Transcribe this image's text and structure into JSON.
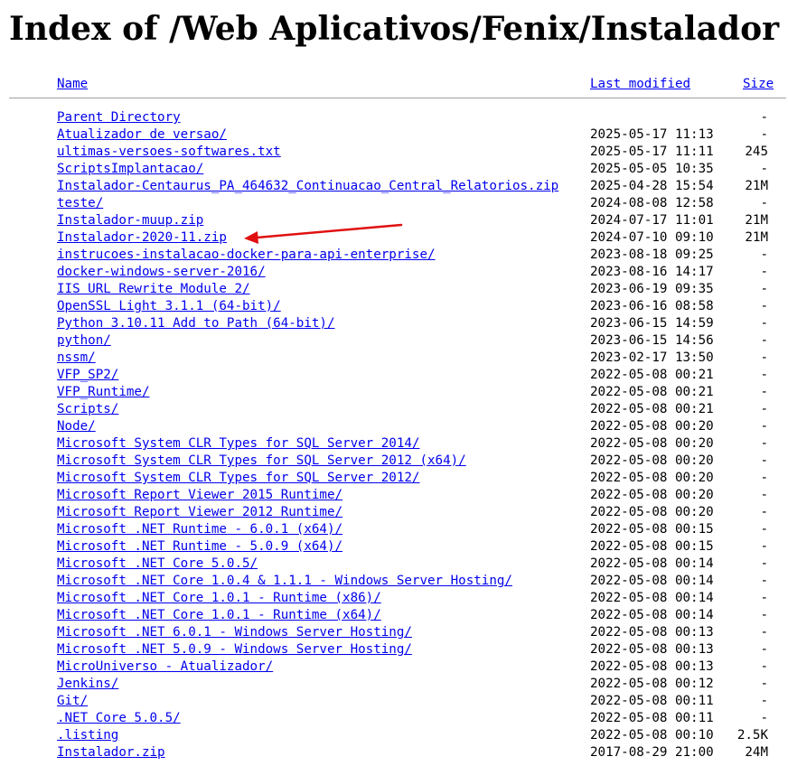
{
  "page": {
    "title": "Index of /Web Aplicativos/Fenix/Instalador"
  },
  "columns": {
    "name": "Name",
    "last_modified": "Last modified",
    "size": "Size"
  },
  "colors": {
    "link": "#0000ee",
    "arrow": "#e01010"
  },
  "annotation": {
    "icon": "red-arrow-icon",
    "points_to_row": 7
  },
  "rows": [
    {
      "name": "Parent Directory",
      "modified": "",
      "size": "-"
    },
    {
      "name": "Atualizador de versao/",
      "modified": "2025-05-17 11:13",
      "size": "-"
    },
    {
      "name": "ultimas-versoes-softwares.txt",
      "modified": "2025-05-17 11:11",
      "size": "245"
    },
    {
      "name": "ScriptsImplantacao/",
      "modified": "2025-05-05 10:35",
      "size": "-"
    },
    {
      "name": "Instalador-Centaurus_PA_464632_Continuacao_Central_Relatorios.zip",
      "modified": "2025-04-28 15:54",
      "size": "21M"
    },
    {
      "name": "teste/",
      "modified": "2024-08-08 12:58",
      "size": "-"
    },
    {
      "name": "Instalador-muup.zip",
      "modified": "2024-07-17 11:01",
      "size": "21M"
    },
    {
      "name": "Instalador-2020-11.zip",
      "modified": "2024-07-10 09:10",
      "size": "21M"
    },
    {
      "name": "instrucoes-instalacao-docker-para-api-enterprise/",
      "modified": "2023-08-18 09:25",
      "size": "-"
    },
    {
      "name": "docker-windows-server-2016/",
      "modified": "2023-08-16 14:17",
      "size": "-"
    },
    {
      "name": "IIS URL Rewrite Module 2/",
      "modified": "2023-06-19 09:35",
      "size": "-"
    },
    {
      "name": "OpenSSL Light 3.1.1 (64-bit)/",
      "modified": "2023-06-16 08:58",
      "size": "-"
    },
    {
      "name": "Python 3.10.11 Add to Path (64-bit)/",
      "modified": "2023-06-15 14:59",
      "size": "-"
    },
    {
      "name": "python/",
      "modified": "2023-06-15 14:56",
      "size": "-"
    },
    {
      "name": "nssm/",
      "modified": "2023-02-17 13:50",
      "size": "-"
    },
    {
      "name": "VFP_SP2/",
      "modified": "2022-05-08 00:21",
      "size": "-"
    },
    {
      "name": "VFP_Runtime/",
      "modified": "2022-05-08 00:21",
      "size": "-"
    },
    {
      "name": "Scripts/",
      "modified": "2022-05-08 00:21",
      "size": "-"
    },
    {
      "name": "Node/",
      "modified": "2022-05-08 00:20",
      "size": "-"
    },
    {
      "name": "Microsoft System CLR Types for SQL Server 2014/",
      "modified": "2022-05-08 00:20",
      "size": "-"
    },
    {
      "name": "Microsoft System CLR Types for SQL Server 2012 (x64)/",
      "modified": "2022-05-08 00:20",
      "size": "-"
    },
    {
      "name": "Microsoft System CLR Types for SQL Server 2012/",
      "modified": "2022-05-08 00:20",
      "size": "-"
    },
    {
      "name": "Microsoft Report Viewer 2015 Runtime/",
      "modified": "2022-05-08 00:20",
      "size": "-"
    },
    {
      "name": "Microsoft Report Viewer 2012 Runtime/",
      "modified": "2022-05-08 00:20",
      "size": "-"
    },
    {
      "name": "Microsoft .NET Runtime - 6.0.1 (x64)/",
      "modified": "2022-05-08 00:15",
      "size": "-"
    },
    {
      "name": "Microsoft .NET Runtime - 5.0.9 (x64)/",
      "modified": "2022-05-08 00:15",
      "size": "-"
    },
    {
      "name": "Microsoft .NET Core 5.0.5/",
      "modified": "2022-05-08 00:14",
      "size": "-"
    },
    {
      "name": "Microsoft .NET Core 1.0.4 & 1.1.1 - Windows Server Hosting/",
      "modified": "2022-05-08 00:14",
      "size": "-"
    },
    {
      "name": "Microsoft .NET Core 1.0.1 - Runtime (x86)/",
      "modified": "2022-05-08 00:14",
      "size": "-"
    },
    {
      "name": "Microsoft .NET Core 1.0.1 - Runtime (x64)/",
      "modified": "2022-05-08 00:14",
      "size": "-"
    },
    {
      "name": "Microsoft .NET 6.0.1 - Windows Server Hosting/",
      "modified": "2022-05-08 00:13",
      "size": "-"
    },
    {
      "name": "Microsoft .NET 5.0.9 - Windows Server Hosting/",
      "modified": "2022-05-08 00:13",
      "size": "-"
    },
    {
      "name": "MicroUniverso - Atualizador/",
      "modified": "2022-05-08 00:13",
      "size": "-"
    },
    {
      "name": "Jenkins/",
      "modified": "2022-05-08 00:12",
      "size": "-"
    },
    {
      "name": "Git/",
      "modified": "2022-05-08 00:11",
      "size": "-"
    },
    {
      "name": ".NET Core 5.0.5/",
      "modified": "2022-05-08 00:11",
      "size": "-"
    },
    {
      "name": ".listing",
      "modified": "2022-05-08 00:10",
      "size": "2.5K"
    },
    {
      "name": "Instalador.zip",
      "modified": "2017-08-29 21:00",
      "size": "24M"
    }
  ]
}
